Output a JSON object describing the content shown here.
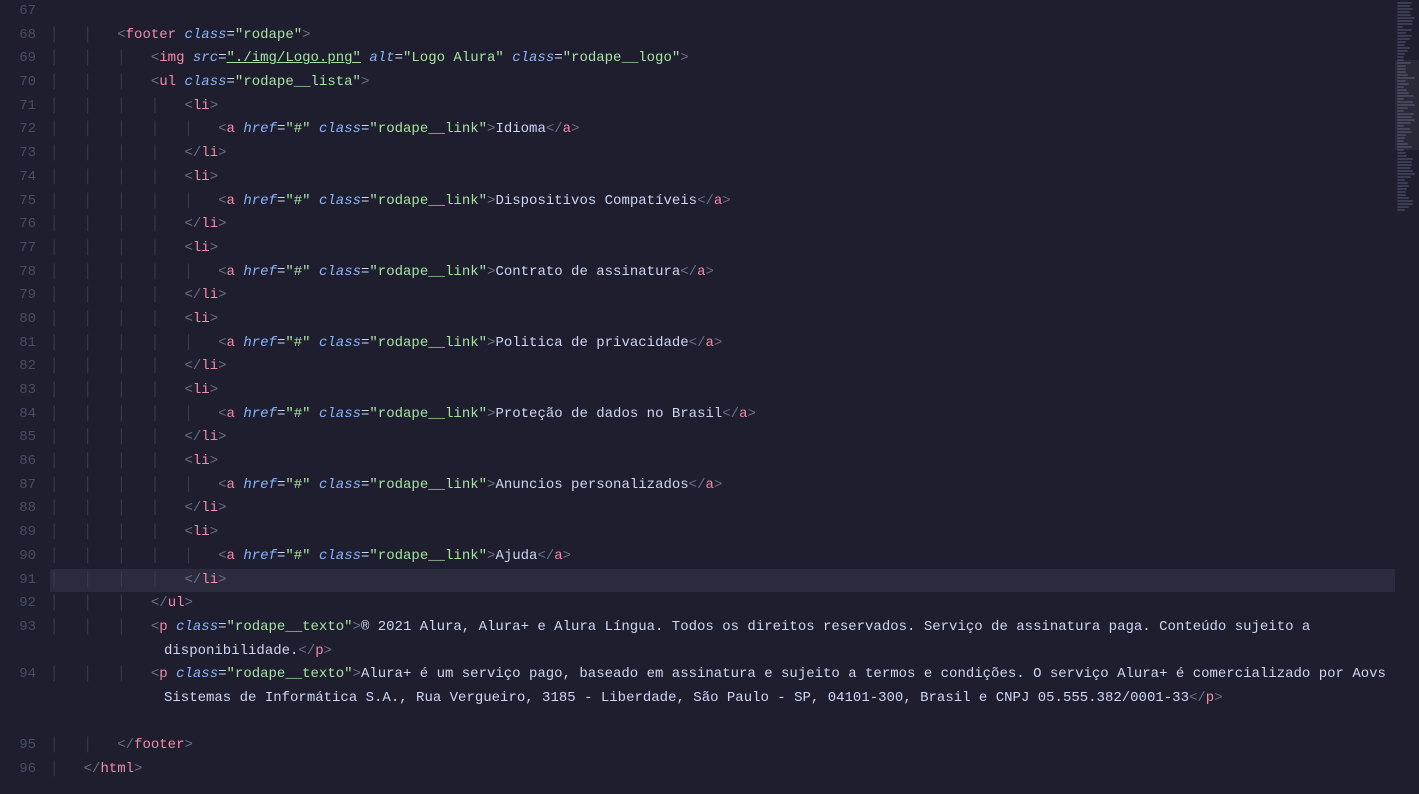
{
  "gutter": {
    "start": 67,
    "end": 96
  },
  "lines": [
    {
      "n": 67,
      "indent": 0,
      "segs": []
    },
    {
      "n": 68,
      "indent": 2,
      "segs": [
        {
          "t": "open",
          "tag": "footer",
          "attrs": [
            {
              "name": "class",
              "value": "rodape"
            }
          ]
        }
      ]
    },
    {
      "n": 69,
      "indent": 3,
      "segs": [
        {
          "t": "open",
          "tag": "img",
          "attrs": [
            {
              "name": "src",
              "value": "./img/Logo.png",
              "underline": true
            },
            {
              "name": "alt",
              "value": "Logo Alura"
            },
            {
              "name": "class",
              "value": "rodape__logo"
            }
          ]
        }
      ]
    },
    {
      "n": 70,
      "indent": 3,
      "segs": [
        {
          "t": "open",
          "tag": "ul",
          "attrs": [
            {
              "name": "class",
              "value": "rodape__lista"
            }
          ]
        }
      ]
    },
    {
      "n": 71,
      "indent": 4,
      "segs": [
        {
          "t": "open",
          "tag": "li"
        }
      ]
    },
    {
      "n": 72,
      "indent": 5,
      "segs": [
        {
          "t": "open",
          "tag": "a",
          "attrs": [
            {
              "name": "href",
              "value": "#"
            },
            {
              "name": "class",
              "value": "rodape__link"
            }
          ]
        },
        {
          "t": "text",
          "text": "Idioma"
        },
        {
          "t": "close",
          "tag": "a"
        }
      ]
    },
    {
      "n": 73,
      "indent": 4,
      "segs": [
        {
          "t": "close",
          "tag": "li"
        }
      ]
    },
    {
      "n": 74,
      "indent": 4,
      "segs": [
        {
          "t": "open",
          "tag": "li"
        }
      ]
    },
    {
      "n": 75,
      "indent": 5,
      "segs": [
        {
          "t": "open",
          "tag": "a",
          "attrs": [
            {
              "name": "href",
              "value": "#"
            },
            {
              "name": "class",
              "value": "rodape__link"
            }
          ]
        },
        {
          "t": "text",
          "text": "Dispositivos Compatíveis"
        },
        {
          "t": "close",
          "tag": "a"
        }
      ]
    },
    {
      "n": 76,
      "indent": 4,
      "segs": [
        {
          "t": "close",
          "tag": "li"
        }
      ]
    },
    {
      "n": 77,
      "indent": 4,
      "segs": [
        {
          "t": "open",
          "tag": "li"
        }
      ]
    },
    {
      "n": 78,
      "indent": 5,
      "segs": [
        {
          "t": "open",
          "tag": "a",
          "attrs": [
            {
              "name": "href",
              "value": "#"
            },
            {
              "name": "class",
              "value": "rodape__link"
            }
          ]
        },
        {
          "t": "text",
          "text": "Contrato de assinatura"
        },
        {
          "t": "close",
          "tag": "a"
        }
      ]
    },
    {
      "n": 79,
      "indent": 4,
      "segs": [
        {
          "t": "close",
          "tag": "li"
        }
      ]
    },
    {
      "n": 80,
      "indent": 4,
      "segs": [
        {
          "t": "open",
          "tag": "li"
        }
      ]
    },
    {
      "n": 81,
      "indent": 5,
      "segs": [
        {
          "t": "open",
          "tag": "a",
          "attrs": [
            {
              "name": "href",
              "value": "#"
            },
            {
              "name": "class",
              "value": "rodape__link"
            }
          ]
        },
        {
          "t": "text",
          "text": "Politica de privacidade"
        },
        {
          "t": "close",
          "tag": "a"
        }
      ]
    },
    {
      "n": 82,
      "indent": 4,
      "segs": [
        {
          "t": "close",
          "tag": "li"
        }
      ]
    },
    {
      "n": 83,
      "indent": 4,
      "segs": [
        {
          "t": "open",
          "tag": "li"
        }
      ]
    },
    {
      "n": 84,
      "indent": 5,
      "segs": [
        {
          "t": "open",
          "tag": "a",
          "attrs": [
            {
              "name": "href",
              "value": "#"
            },
            {
              "name": "class",
              "value": "rodape__link"
            }
          ]
        },
        {
          "t": "text",
          "text": "Proteção de dados no Brasil"
        },
        {
          "t": "close",
          "tag": "a"
        }
      ]
    },
    {
      "n": 85,
      "indent": 4,
      "segs": [
        {
          "t": "close",
          "tag": "li"
        }
      ]
    },
    {
      "n": 86,
      "indent": 4,
      "segs": [
        {
          "t": "open",
          "tag": "li"
        }
      ]
    },
    {
      "n": 87,
      "indent": 5,
      "segs": [
        {
          "t": "open",
          "tag": "a",
          "attrs": [
            {
              "name": "href",
              "value": "#"
            },
            {
              "name": "class",
              "value": "rodape__link"
            }
          ]
        },
        {
          "t": "text",
          "text": "Anuncios personalizados"
        },
        {
          "t": "close",
          "tag": "a"
        }
      ]
    },
    {
      "n": 88,
      "indent": 4,
      "segs": [
        {
          "t": "close",
          "tag": "li"
        }
      ]
    },
    {
      "n": 89,
      "indent": 4,
      "segs": [
        {
          "t": "open",
          "tag": "li"
        }
      ]
    },
    {
      "n": 90,
      "indent": 5,
      "segs": [
        {
          "t": "open",
          "tag": "a",
          "attrs": [
            {
              "name": "href",
              "value": "#"
            },
            {
              "name": "class",
              "value": "rodape__link"
            }
          ]
        },
        {
          "t": "text",
          "text": "Ajuda"
        },
        {
          "t": "close",
          "tag": "a"
        }
      ]
    },
    {
      "n": 91,
      "indent": 4,
      "segs": [
        {
          "t": "close",
          "tag": "li"
        }
      ],
      "highlighted": true
    },
    {
      "n": 92,
      "indent": 3,
      "segs": [
        {
          "t": "close",
          "tag": "ul"
        }
      ]
    },
    {
      "n": 93,
      "indent": 3,
      "wrap": true,
      "segs": [
        {
          "t": "open",
          "tag": "p",
          "attrs": [
            {
              "name": "class",
              "value": "rodape__texto"
            }
          ]
        },
        {
          "t": "text",
          "text": "® 2021 Alura, Alura+ e Alura Língua. Todos os direitos reservados. Serviço de assinatura paga. Conteúdo sujeito a disponibilidade."
        },
        {
          "t": "close",
          "tag": "p"
        }
      ]
    },
    {
      "n": 94,
      "indent": 3,
      "wrap": true,
      "segs": [
        {
          "t": "open",
          "tag": "p",
          "attrs": [
            {
              "name": "class",
              "value": "rodape__texto"
            }
          ]
        },
        {
          "t": "text",
          "text": "Alura+ é um serviço pago, baseado em assinatura e sujeito a termos e condições. O serviço Alura+ é comercializado por Aovs Sistemas de Informática S.A., Rua Vergueiro, 3185 - Liberdade, São Paulo - SP, 04101-300, Brasil e CNPJ 05.555.382/0001-33"
        },
        {
          "t": "close",
          "tag": "p"
        }
      ]
    },
    {
      "n": 95,
      "indent": 2,
      "segs": [
        {
          "t": "close",
          "tag": "footer"
        }
      ]
    },
    {
      "n": 96,
      "indent": 1,
      "segs": [
        {
          "t": "close",
          "tag": "html"
        }
      ]
    }
  ],
  "wrap_extra": {
    "93": 1,
    "94": 2
  }
}
